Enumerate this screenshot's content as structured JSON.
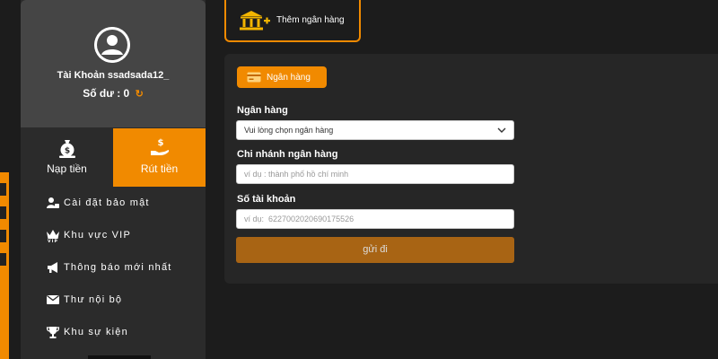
{
  "profile": {
    "account_label": "Tài Khoản ssadsada12_",
    "balance_label": "Số dư : 0"
  },
  "tabs": {
    "deposit": "Nạp tiền",
    "withdraw": "Rút tiền"
  },
  "menu": {
    "items": [
      {
        "label": "Cài đặt bảo mật",
        "icon": "user-lock-icon"
      },
      {
        "label": "Khu vực VIP",
        "icon": "crown-icon"
      },
      {
        "label": "Thông báo mới nhất",
        "icon": "megaphone-icon"
      },
      {
        "label": "Thư nội bộ",
        "icon": "envelope-icon"
      },
      {
        "label": "Khu sự kiện",
        "icon": "trophy-icon"
      }
    ]
  },
  "top": {
    "add_bank_label": "Thêm ngân hàng"
  },
  "form": {
    "bank_tab_label": "Ngân hàng",
    "bank_label": "Ngân hàng",
    "bank_select_value": "Vui lòng chọn ngân hàng",
    "branch_label": "Chi nhánh ngân hàng",
    "branch_placeholder": "ví dụ : thành phố hồ chí minh",
    "account_number_label": "Số tài khoản",
    "account_number_placeholder": "ví dụ:  6227002020690175526",
    "submit_label": "gửi đi"
  },
  "colors": {
    "accent": "#f18a00",
    "submit": "#a86414",
    "background": "#1c1c1c",
    "panel": "#262626"
  }
}
